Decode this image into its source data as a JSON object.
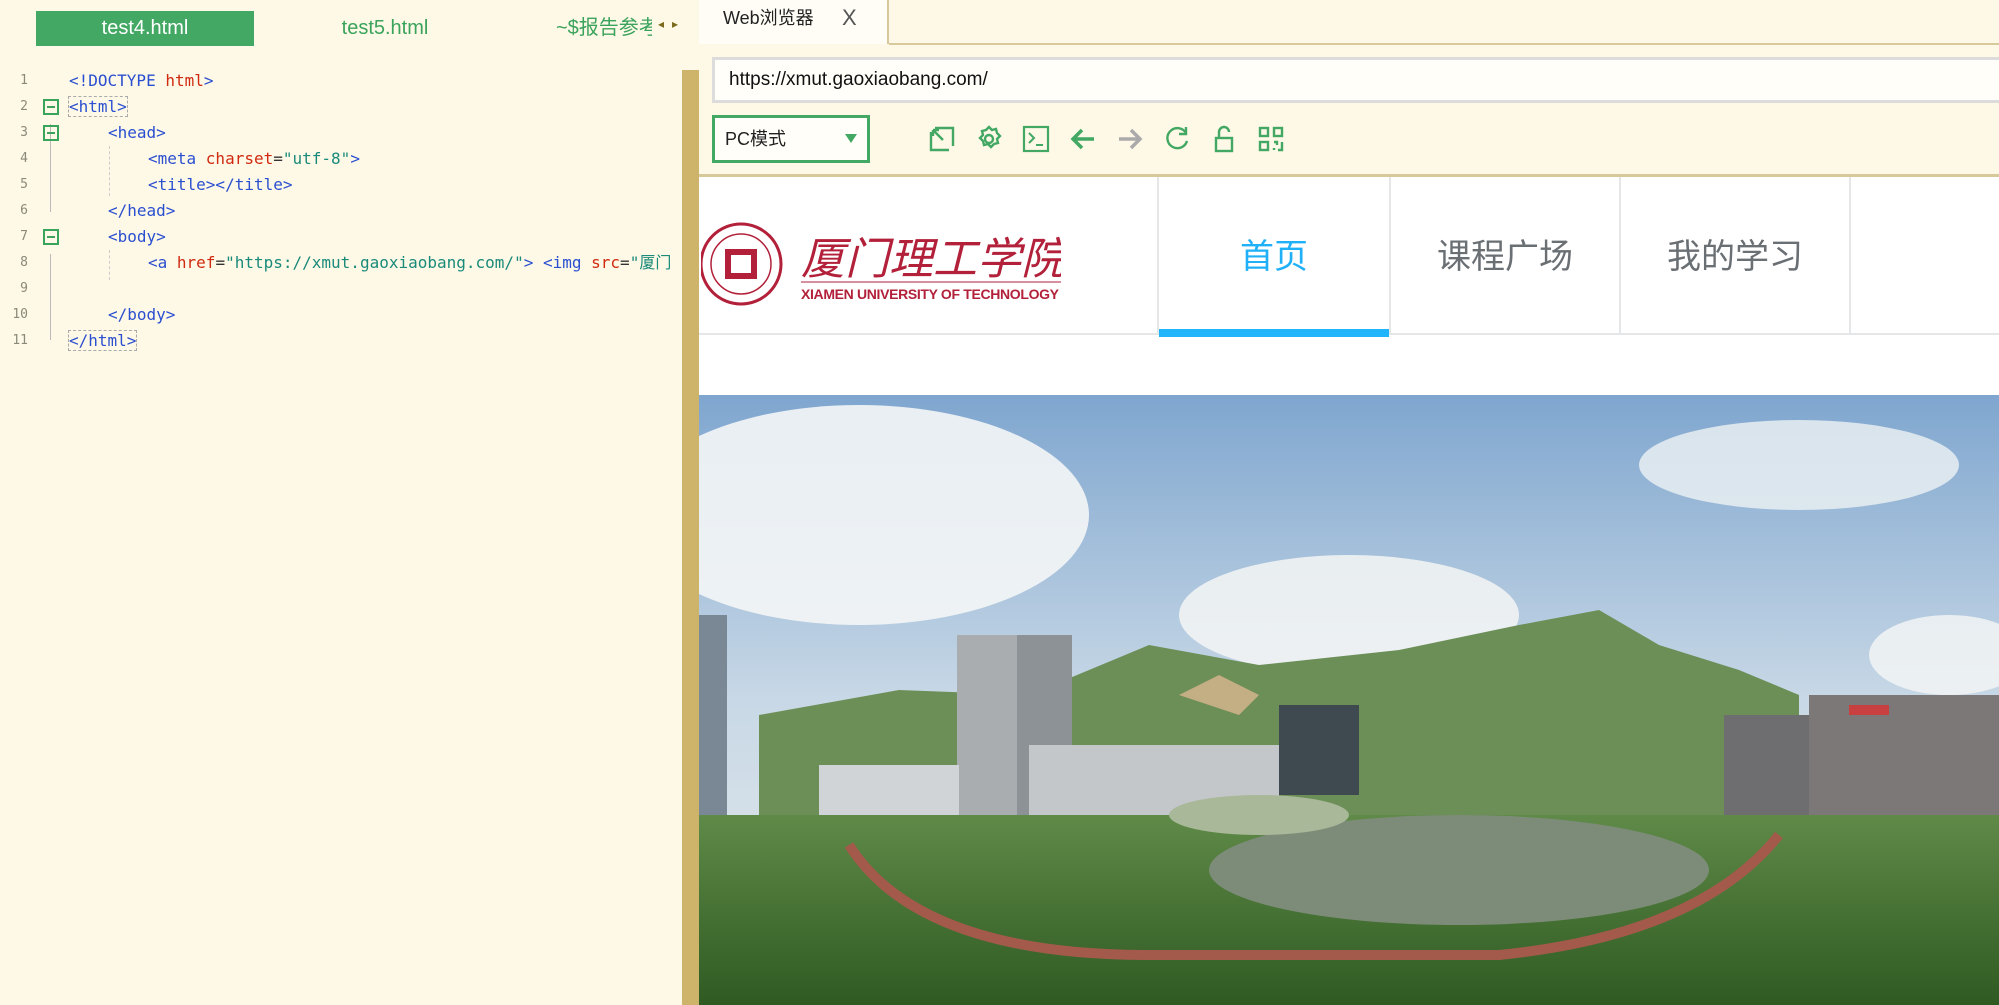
{
  "editor": {
    "tabs": [
      {
        "label": "test4.html",
        "active": true
      },
      {
        "label": "test5.html",
        "active": false
      },
      {
        "label": "~$报告参考"
      }
    ],
    "tab_arrows": "◂▸",
    "lines": [
      {
        "n": "1",
        "parts": [
          "<!DOCTYPE ",
          "html",
          ">"
        ]
      },
      {
        "n": "2",
        "parts": [
          "<html>"
        ]
      },
      {
        "n": "3",
        "parts": [
          "<head>"
        ]
      },
      {
        "n": "4",
        "parts": [
          "<meta ",
          "charset",
          "=",
          "\"utf-8\"",
          ">"
        ]
      },
      {
        "n": "5",
        "parts": [
          "<title></title>"
        ]
      },
      {
        "n": "6",
        "parts": [
          "</head>"
        ]
      },
      {
        "n": "7",
        "parts": [
          "<body>"
        ]
      },
      {
        "n": "8",
        "parts": [
          "<a ",
          "href",
          "=",
          "\"https://xmut.gaoxiaobang.com/\"",
          "> <img ",
          "src",
          "=",
          "\"厦门"
        ]
      },
      {
        "n": "9",
        "parts": []
      },
      {
        "n": "10",
        "parts": [
          "</body>"
        ]
      },
      {
        "n": "11",
        "parts": [
          "</html>"
        ]
      }
    ]
  },
  "browser": {
    "tab_label": "Web浏览器",
    "close_glyph": "X",
    "url": "https://xmut.gaoxiaobang.com/",
    "mode": "PC模式",
    "accent": "#42a863"
  },
  "site": {
    "logo_cn": "厦门理工学院",
    "logo_en": "XIAMEN UNIVERSITY OF TECHNOLOGY",
    "nav": [
      {
        "label": "首页",
        "active": true
      },
      {
        "label": "课程广场"
      },
      {
        "label": "我的学习"
      }
    ],
    "active_color": "#20b4fa"
  }
}
